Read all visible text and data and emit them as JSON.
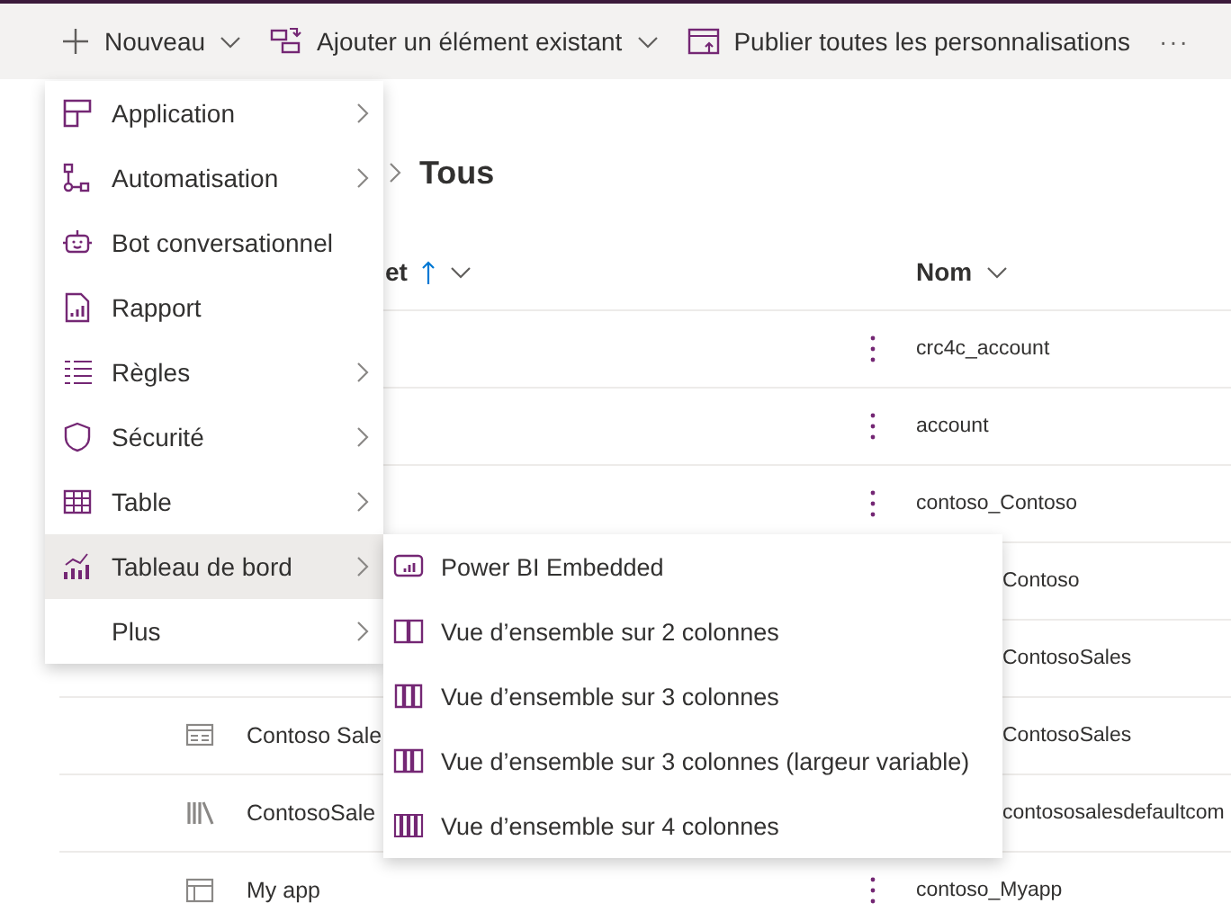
{
  "toolbar": {
    "items": [
      {
        "kind": "new",
        "label": "Nouveau",
        "dropdown": true
      },
      {
        "kind": "add",
        "label": "Ajouter un élément existant",
        "dropdown": true
      },
      {
        "kind": "publish",
        "label": "Publier toutes les personnalisations",
        "dropdown": false
      }
    ],
    "overflow": "···"
  },
  "breadcrumb": {
    "current": "Tous"
  },
  "table": {
    "columns": [
      {
        "label": "et",
        "sorted": true
      },
      {
        "label": "Nom",
        "sorted": false
      }
    ],
    "rows": [
      {
        "kind": "full",
        "name": "crc4c_account"
      },
      {
        "kind": "full",
        "name": "account"
      },
      {
        "kind": "full",
        "name": "contoso_Contoso"
      },
      {
        "kind": "clipped",
        "name": "Contoso"
      },
      {
        "kind": "clipped",
        "name": "ContosoSales"
      },
      {
        "kind": "clipped",
        "display_name": "Contoso Sale",
        "name": "ContosoSales"
      },
      {
        "kind": "clipped",
        "display_name": "ContosoSale",
        "name": "contososalesdefaultcom"
      },
      {
        "kind": "full",
        "display_name": "My app",
        "name": "contoso_Myapp"
      }
    ]
  },
  "menu": {
    "items": [
      {
        "label": "Application",
        "kind": "submenu",
        "selected": false
      },
      {
        "label": "Automatisation",
        "kind": "submenu",
        "selected": false
      },
      {
        "label": "Bot conversationnel",
        "kind": "external",
        "selected": false
      },
      {
        "label": "Rapport",
        "kind": "plain",
        "selected": false
      },
      {
        "label": "Règles",
        "kind": "submenu",
        "selected": false
      },
      {
        "label": "Sécurité",
        "kind": "submenu",
        "selected": false
      },
      {
        "label": "Table",
        "kind": "submenu",
        "selected": false
      },
      {
        "label": "Tableau de bord",
        "kind": "submenu",
        "selected": true
      },
      {
        "label": "Plus",
        "kind": "submenu",
        "selected": false
      }
    ]
  },
  "submenu": {
    "items": [
      {
        "label": "Power BI Embedded"
      },
      {
        "label": "Vue d’ensemble sur 2 colonnes"
      },
      {
        "label": "Vue d’ensemble sur 3 colonnes"
      },
      {
        "label": "Vue d’ensemble sur 3 colonnes (largeur variable)"
      },
      {
        "label": "Vue d’ensemble sur 4 colonnes"
      }
    ]
  }
}
